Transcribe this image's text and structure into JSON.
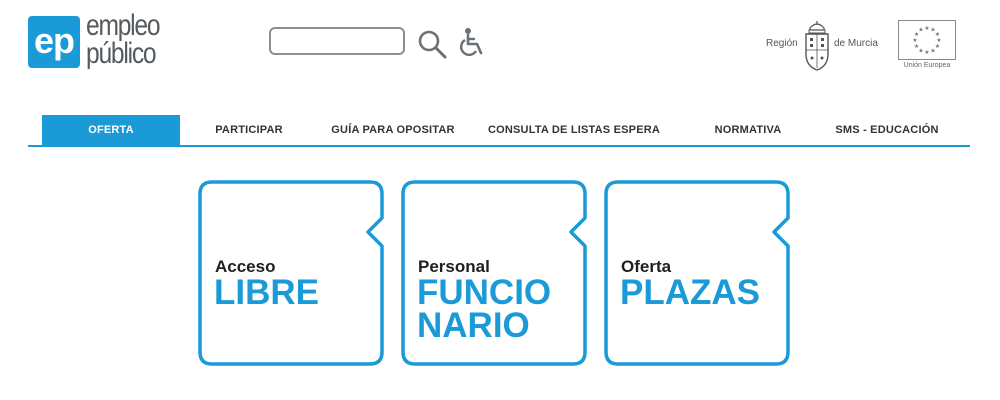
{
  "header": {
    "logo": {
      "badge": "ep",
      "line1": "empleo",
      "line2": "público"
    },
    "search": {
      "value": "",
      "placeholder": ""
    },
    "region": {
      "left": "Región",
      "right": "de Murcia"
    },
    "eu": {
      "caption": "Unión Europea"
    }
  },
  "nav": {
    "items": [
      {
        "label": "OFERTA",
        "active": true
      },
      {
        "label": "PARTICIPAR",
        "active": false
      },
      {
        "label": "GUÍA PARA OPOSITAR",
        "active": false
      },
      {
        "label": "CONSULTA DE LISTAS ESPERA",
        "active": false
      },
      {
        "label": "NORMATIVA",
        "active": false
      },
      {
        "label": "SMS - EDUCACIÓN",
        "active": false
      }
    ]
  },
  "cards": [
    {
      "small": "Acceso",
      "big1": "LIBRE",
      "big2": ""
    },
    {
      "small": "Personal",
      "big1": "FUNCIO",
      "big2": "NARIO"
    },
    {
      "small": "Oferta",
      "big1": "PLAZAS",
      "big2": ""
    }
  ],
  "colors": {
    "accent": "#1a9ad6",
    "text_dark": "#1f1f1f",
    "logo_gray": "#555a5e"
  },
  "icons": {
    "search": "search-icon",
    "accessibility": "wheelchair-icon",
    "coat_of_arms": "coat-of-arms-icon",
    "eu_flag": "eu-flag-icon"
  }
}
